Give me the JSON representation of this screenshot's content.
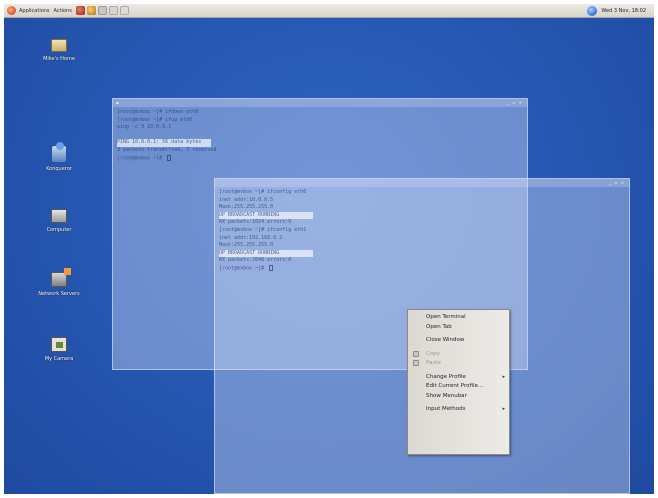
{
  "panel": {
    "menus": [
      "Applications",
      "Actions"
    ],
    "clock": "Wed 3 Nov, 18:02"
  },
  "desktop_icons": [
    {
      "label": "Mike's Home",
      "icon": "home-folder-icon"
    },
    {
      "label": "Konqueror",
      "icon": "network-globe-icon"
    },
    {
      "label": "Computer",
      "icon": "computer-icon"
    },
    {
      "label": "Network Servers",
      "icon": "network-servers-icon"
    },
    {
      "label": "My Camera",
      "icon": "camera-icon"
    }
  ],
  "terminal_back": {
    "lines": [
      "[root@mvbox ~]# ifdown eth0",
      "[root@mvbox ~]# ifup eth0",
      "ping -c 3 10.0.0.1",
      "",
      "PING 10.0.0.1: 56 data bytes",
      "3 packets transmitted, 3 received",
      "[root@mvbox ~]# "
    ]
  },
  "terminal_front": {
    "lines": [
      "[root@mvbox ~]# ifconfig eth0",
      "inet addr:10.0.0.5",
      "Mask:255.255.255.0",
      "UP BROADCAST RUNNING",
      "RX packets:1024 errors:0",
      "[root@mvbox ~]# ifconfig eth1",
      "inet addr:192.168.0.2",
      "Mask:255.255.255.0",
      "UP BROADCAST RUNNING",
      "RX packets:2048 errors:0",
      "[root@mvbox ~]# "
    ]
  },
  "context_menu": {
    "items": [
      {
        "label": "Open Terminal"
      },
      {
        "label": "Open Tab"
      },
      {
        "label": "Close Window"
      },
      {
        "label": "Copy"
      },
      {
        "label": "Paste"
      },
      {
        "label": "Change Profile"
      },
      {
        "label": "Edit Current Profile..."
      },
      {
        "label": "Show Menubar"
      },
      {
        "label": "Input Methods"
      }
    ]
  }
}
